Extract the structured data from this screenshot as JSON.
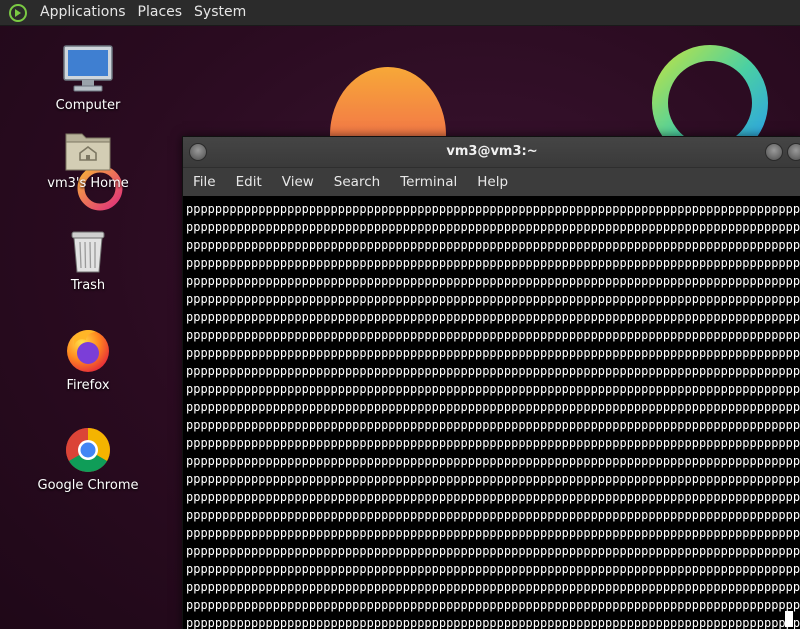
{
  "top_panel": {
    "menus": [
      "Applications",
      "Places",
      "System"
    ]
  },
  "desktop_icons": [
    {
      "label": "Computer",
      "icon": "computer-icon"
    },
    {
      "label": "vm3's Home",
      "icon": "home-folder-icon"
    },
    {
      "label": "Trash",
      "icon": "trash-icon"
    },
    {
      "label": "Firefox",
      "icon": "firefox-icon"
    },
    {
      "label": "Google Chrome",
      "icon": "chrome-icon"
    }
  ],
  "terminal": {
    "title": "vm3@vm3:~",
    "menus": [
      "File",
      "Edit",
      "View",
      "Search",
      "Terminal",
      "Help"
    ],
    "line_text": "pppppppppppppppppppppppppppppppppppppppppppppppppppppppppppppppppppppppppppppppppppppppppp",
    "line_count": 24
  },
  "colors": {
    "panel_bg": "#2b2b2b",
    "wallpaper": "#2c0f22",
    "terminal_bg": "#000000",
    "terminal_fg": "#ffffff"
  }
}
